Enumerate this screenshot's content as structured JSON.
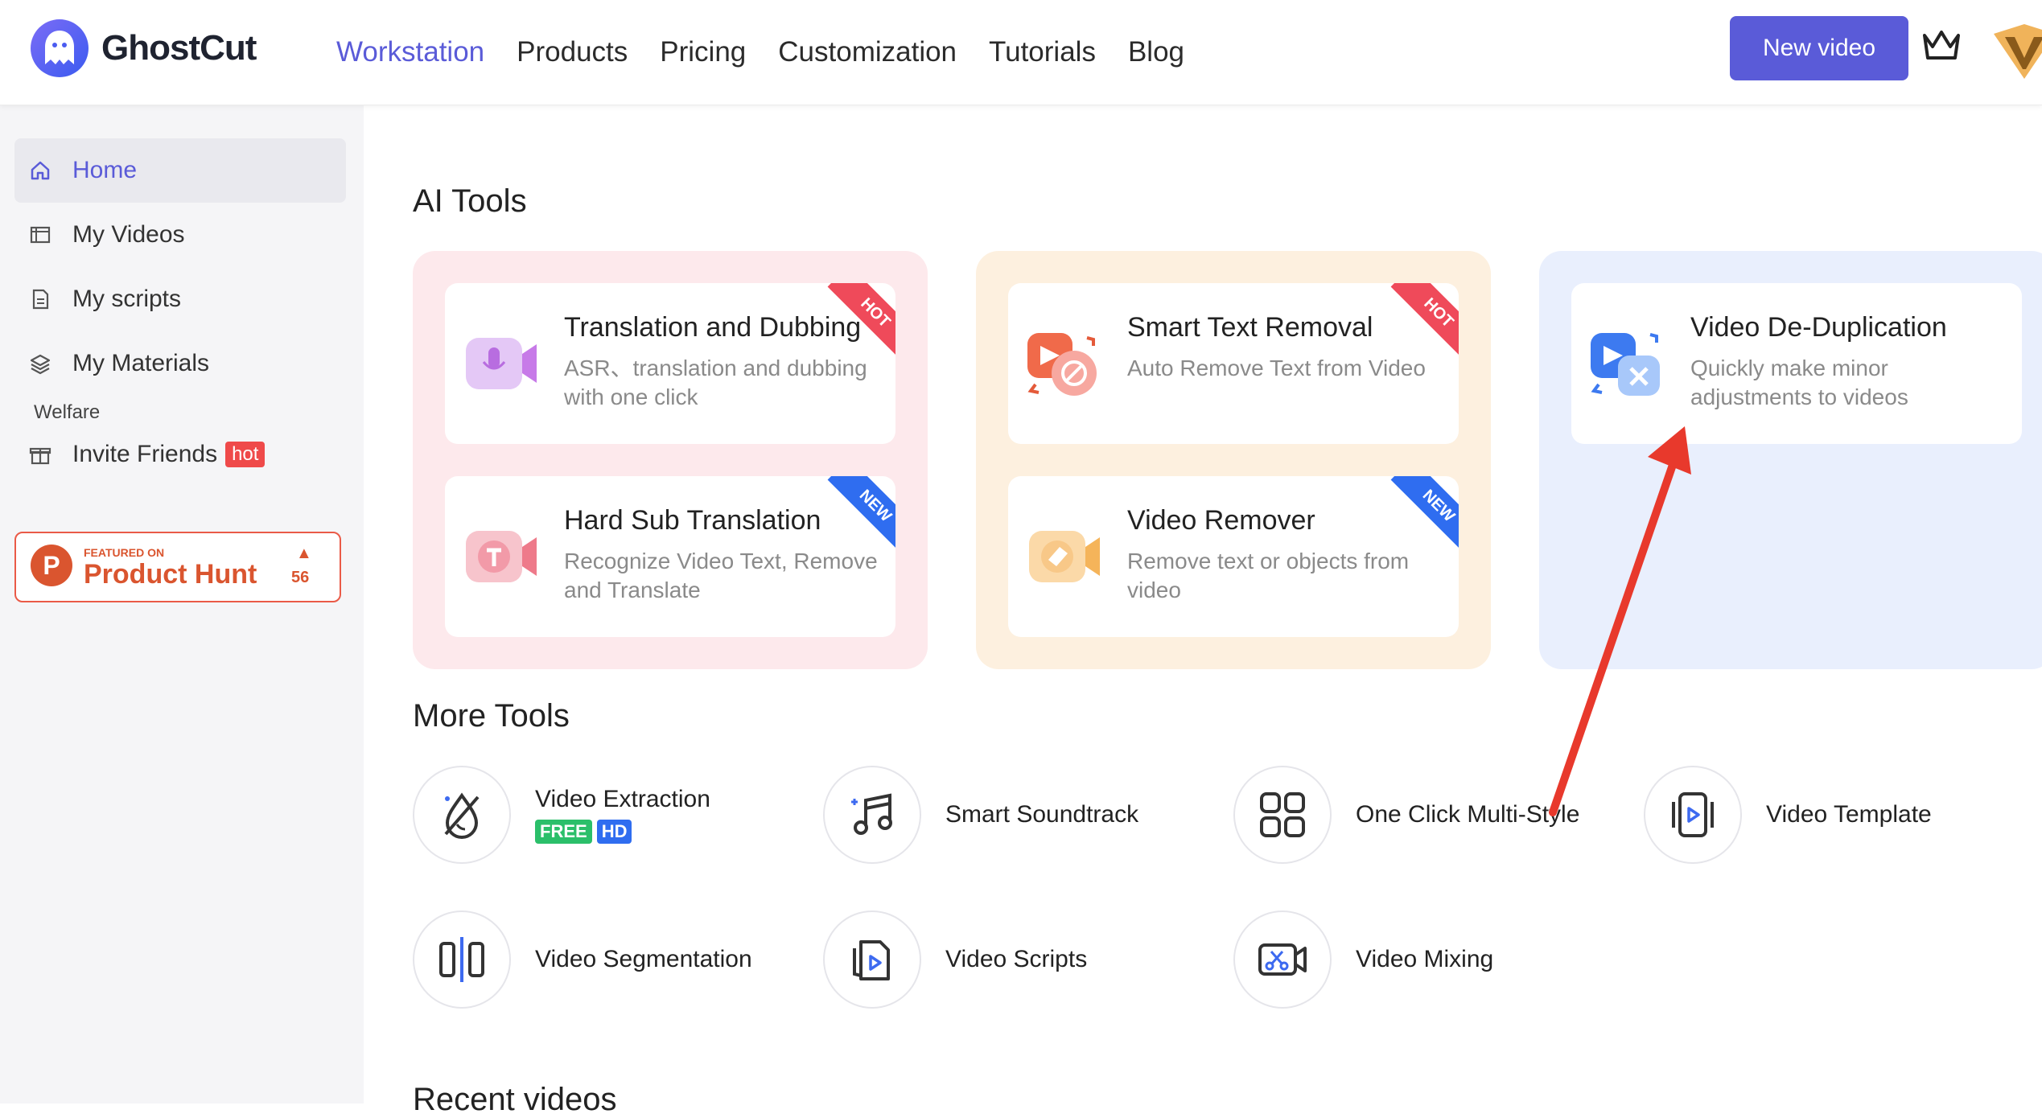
{
  "brand": {
    "name": "GhostCut",
    "accent": "#5a5bd8"
  },
  "nav": [
    {
      "label": "Workstation",
      "active": true
    },
    {
      "label": "Products"
    },
    {
      "label": "Pricing"
    },
    {
      "label": "Customization"
    },
    {
      "label": "Tutorials"
    },
    {
      "label": "Blog"
    }
  ],
  "header": {
    "new_video_label": "New video"
  },
  "sidebar": {
    "items": [
      {
        "label": "Home",
        "icon": "home-icon",
        "active": true
      },
      {
        "label": "My Videos",
        "icon": "film-icon"
      },
      {
        "label": "My scripts",
        "icon": "document-icon"
      },
      {
        "label": "My Materials",
        "icon": "layers-icon"
      }
    ],
    "welfare_label": "Welfare",
    "invite": {
      "label": "Invite Friends",
      "badge": "hot"
    },
    "product_hunt": {
      "featured": "FEATURED ON",
      "name": "Product Hunt",
      "count": "56"
    }
  },
  "ai_tools": {
    "title": "AI Tools",
    "groups": [
      {
        "cards": [
          {
            "title": "Translation and Dubbing",
            "desc": "ASR、translation and dubbing with one click",
            "ribbon": "HOT"
          },
          {
            "title": "Hard Sub Translation",
            "desc": "Recognize Video Text, Remove and Translate",
            "ribbon": "NEW"
          }
        ]
      },
      {
        "cards": [
          {
            "title": "Smart Text Removal",
            "desc": "Auto Remove Text from Video",
            "ribbon": "HOT"
          },
          {
            "title": "Video Remover",
            "desc": "Remove text or objects from video",
            "ribbon": "NEW"
          }
        ]
      },
      {
        "cards": [
          {
            "title": "Video De-Duplication",
            "desc": "Quickly make minor adjustments to videos"
          }
        ]
      }
    ]
  },
  "more_tools": {
    "title": "More Tools",
    "items": [
      {
        "label": "Video Extraction",
        "icon": "extraction-icon",
        "tags": [
          "FREE",
          "HD"
        ]
      },
      {
        "label": "Smart Soundtrack",
        "icon": "music-note-icon"
      },
      {
        "label": "One Click Multi-Style",
        "icon": "grid-icon"
      },
      {
        "label": "Video Template",
        "icon": "template-icon"
      },
      {
        "label": "Video Segmentation",
        "icon": "segmentation-icon"
      },
      {
        "label": "Video Scripts",
        "icon": "script-icon"
      },
      {
        "label": "Video Mixing",
        "icon": "mixing-icon"
      }
    ]
  },
  "recent": {
    "title": "Recent videos"
  }
}
